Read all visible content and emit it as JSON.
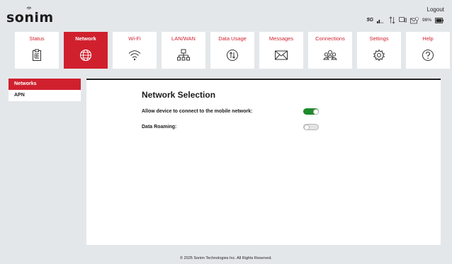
{
  "header": {
    "brand": "sonim",
    "logout": "Logout",
    "network_type": "5G",
    "battery": "98%"
  },
  "tabs": [
    {
      "label": "Status",
      "icon": "clipboard-icon"
    },
    {
      "label": "Network",
      "icon": "globe-icon"
    },
    {
      "label": "Wi-Fi",
      "icon": "wifi-icon"
    },
    {
      "label": "LAN/WAN",
      "icon": "network-tree-icon"
    },
    {
      "label": "Data Usage",
      "icon": "data-usage-icon"
    },
    {
      "label": "Messages",
      "icon": "envelope-icon"
    },
    {
      "label": "Connections",
      "icon": "people-icon"
    },
    {
      "label": "Settings",
      "icon": "gear-icon"
    },
    {
      "label": "Help",
      "icon": "help-icon"
    }
  ],
  "active_tab": "Network",
  "sidebar": {
    "items": [
      {
        "label": "Networks"
      },
      {
        "label": "APN"
      }
    ]
  },
  "content": {
    "title": "Network Selection",
    "rows": [
      {
        "label": "Allow device to connect to the mobile network:",
        "state": "on"
      },
      {
        "label": "Data Roaming:",
        "state": "off"
      }
    ]
  },
  "footer": "© 2025 Sonim Technologies Inc. All Rights Reserved.",
  "colors": {
    "accent": "#d0202e",
    "toggle_on": "#1e8a2c",
    "background": "#e4e7ea"
  }
}
